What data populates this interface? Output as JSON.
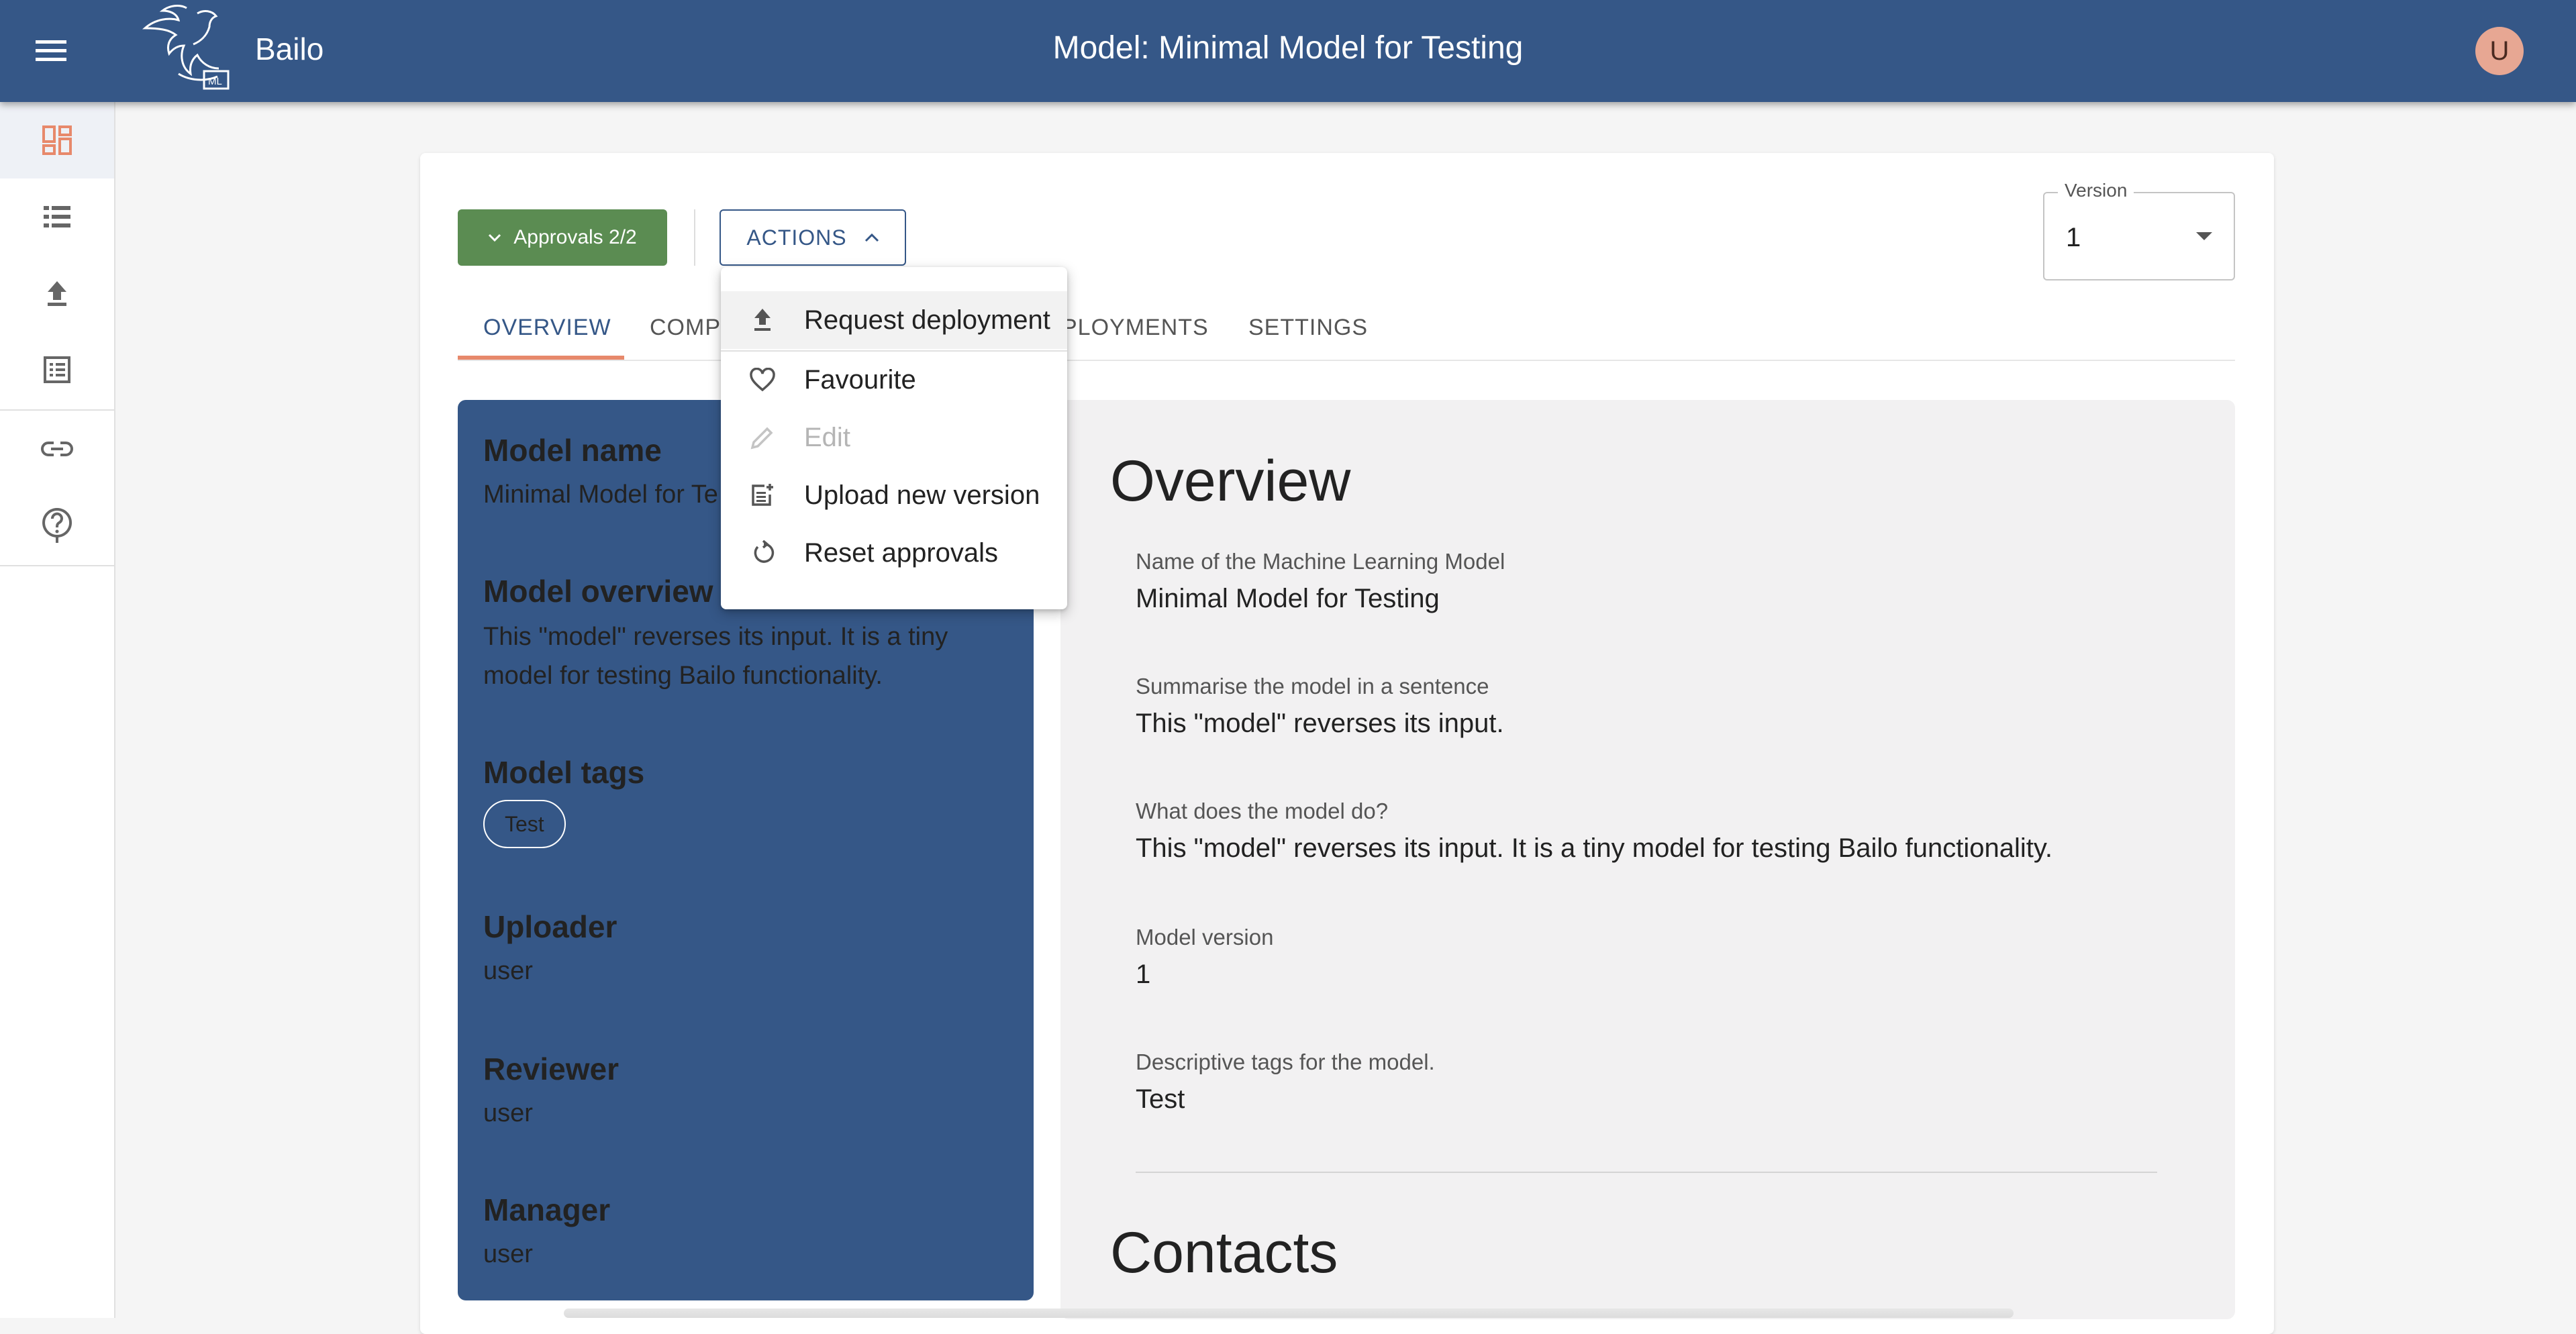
{
  "app": {
    "brand": "Bailo",
    "title": "Model: Minimal Model for Testing",
    "user_initial": "U"
  },
  "colors": {
    "primary": "#355787",
    "approved": "#5b8c52",
    "accent": "#e7896b",
    "avatar": "#e7a793"
  },
  "sidebar": {
    "items": [
      {
        "icon": "dashboard-icon",
        "active": true
      },
      {
        "icon": "list-icon"
      },
      {
        "icon": "upload-icon"
      },
      {
        "icon": "review-list-icon"
      },
      {
        "icon": "link-icon"
      },
      {
        "icon": "help-icon"
      }
    ]
  },
  "toolbar": {
    "approvals_label": "Approvals 2/2",
    "actions_label": "ACTIONS",
    "version_label": "Version",
    "version_value": "1"
  },
  "tabs": [
    {
      "label": "OVERVIEW",
      "active": true
    },
    {
      "label": "COMPL"
    },
    {
      "label": "PLOYMENTS"
    },
    {
      "label": "SETTINGS"
    }
  ],
  "actions_menu": {
    "items": [
      {
        "label": "Request deployment",
        "icon": "upload-icon"
      },
      {
        "label": "Favourite",
        "icon": "heart-outline-icon"
      },
      {
        "label": "Edit",
        "icon": "pencil-icon",
        "disabled": true
      },
      {
        "label": "Upload new version",
        "icon": "post-add-icon"
      },
      {
        "label": "Reset approvals",
        "icon": "restart-icon"
      }
    ]
  },
  "model_info": {
    "name_heading": "Model name",
    "name_value": "Minimal Model for Te",
    "overview_heading": "Model overview",
    "overview_value": "This \"model\" reverses its input. It is a tiny model for testing Bailo functionality.",
    "tags_heading": "Model tags",
    "tag": "Test",
    "uploader_heading": "Uploader",
    "uploader_value": "user",
    "reviewer_heading": "Reviewer",
    "reviewer_value": "user",
    "manager_heading": "Manager",
    "manager_value": "user"
  },
  "overview": {
    "title": "Overview",
    "fields": [
      {
        "label": "Name of the Machine Learning Model",
        "value": "Minimal Model for Testing"
      },
      {
        "label": "Summarise the model in a sentence",
        "value": "This \"model\" reverses its input."
      },
      {
        "label": "What does the model do?",
        "value": "This \"model\" reverses its input. It is a tiny model for testing Bailo functionality."
      },
      {
        "label": "Model version",
        "value": "1"
      },
      {
        "label": "Descriptive tags for the model.",
        "value": "Test"
      }
    ],
    "contacts_title": "Contacts"
  }
}
